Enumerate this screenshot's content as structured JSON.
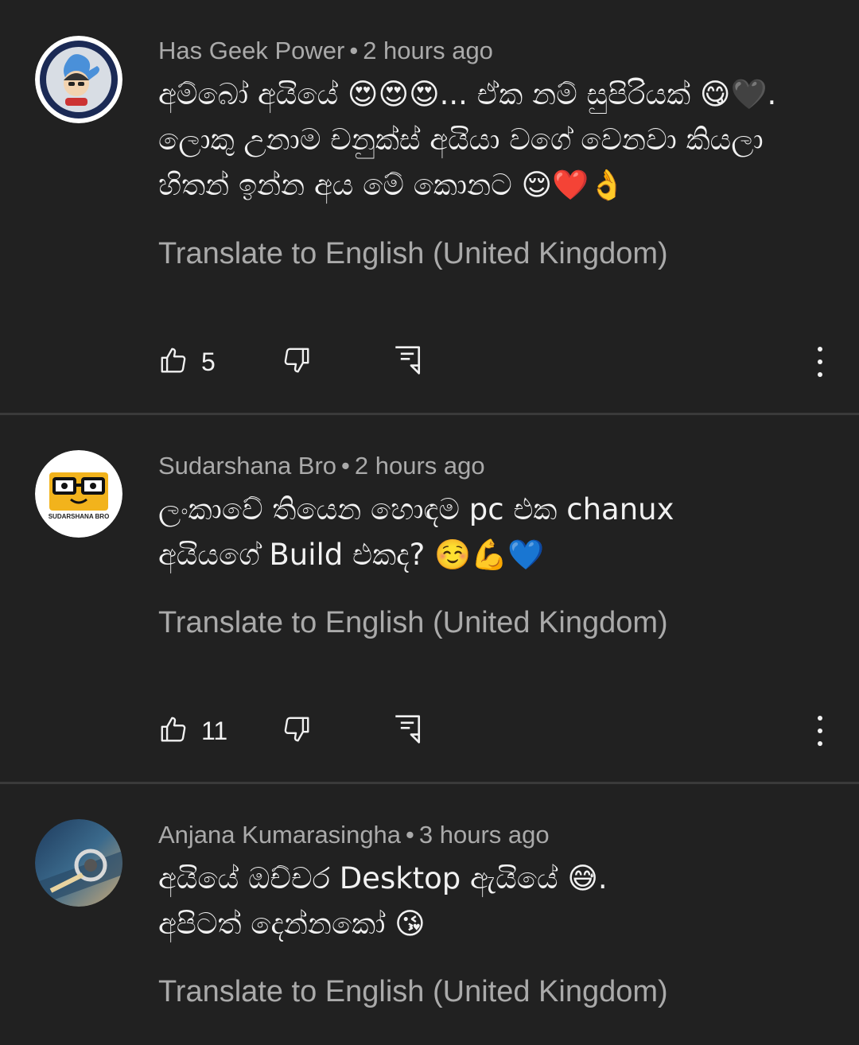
{
  "comments": [
    {
      "author": "Has Geek Power",
      "separator": "•",
      "time": "2 hours ago",
      "text": "අම්බෝ අයියේ 😍😍😍... ඒක නම් සුපිරියක් 😋🖤. ලොකු උනාම චනුක්ස් අයියා වගේ වෙනවා කියලා හිතන් ඉන්න අය මේ කොනට 😌❤️👌",
      "translate": "Translate to English (United Kingdom)",
      "likes": "5"
    },
    {
      "author": "Sudarshana Bro",
      "separator": "•",
      "time": "2 hours ago",
      "text": "ලංකාවේ තියෙන හොඳම pc එක chanux අයියගේ Build එකද? ☺️💪💙",
      "translate": "Translate to English (United Kingdom)",
      "likes": "11",
      "avatar_caption": "SUDARSHANA BRO"
    },
    {
      "author": "Anjana Kumarasingha",
      "separator": "•",
      "time": "3 hours ago",
      "text": "අයියේ ඔච්චර Desktop ඇයියේ 😅. අපිටත් දෙන්නකෝ 😘",
      "translate": "Translate to English (United Kingdom)"
    }
  ],
  "icons": {
    "like": "thumbs-up-icon",
    "dislike": "thumbs-down-icon",
    "reply": "reply-comment-icon",
    "more": "more-vertical-icon"
  },
  "colors": {
    "background": "#212121",
    "primary_text": "#f1f1f1",
    "secondary_text": "#aaaaaa",
    "divider": "#3a3a3a"
  }
}
